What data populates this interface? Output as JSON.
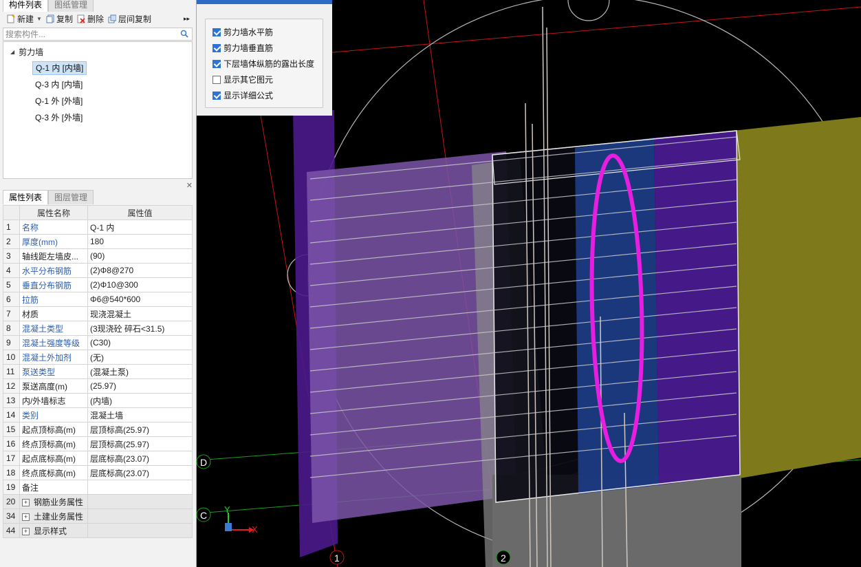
{
  "left_panel": {
    "tabs": [
      "构件列表",
      "图纸管理"
    ],
    "toolbar": {
      "new_label": "新建",
      "copy_label": "复制",
      "delete_label": "删除",
      "floor_copy_label": "层间复制",
      "more": "▸▸"
    },
    "search_placeholder": "搜索构件...",
    "tree": {
      "root": "剪力墙",
      "items": [
        "Q-1 内 [内墙]",
        "Q-3 内 [内墙]",
        "Q-1 外 [外墙]",
        "Q-3 外 [外墙]"
      ]
    },
    "prop_tabs": [
      "属性列表",
      "图层管理"
    ],
    "prop_headers": [
      "属性名称",
      "属性值"
    ],
    "properties": [
      {
        "n": "1",
        "name": "名称",
        "value": "Q-1 内"
      },
      {
        "n": "2",
        "name": "厚度(mm)",
        "value": "180"
      },
      {
        "n": "3",
        "name": "轴线距左墙皮...",
        "value": "(90)"
      },
      {
        "n": "4",
        "name": "水平分布钢筋",
        "value": "(2)Φ8@270"
      },
      {
        "n": "5",
        "name": "垂直分布钢筋",
        "value": "(2)Φ10@300"
      },
      {
        "n": "6",
        "name": "拉筋",
        "value": "Φ6@540*600"
      },
      {
        "n": "7",
        "name": "材质",
        "value": "现浇混凝土"
      },
      {
        "n": "8",
        "name": "混凝土类型",
        "value": "(3现浇砼 碎石<31.5)"
      },
      {
        "n": "9",
        "name": "混凝土强度等级",
        "value": "(C30)"
      },
      {
        "n": "10",
        "name": "混凝土外加剂",
        "value": "(无)"
      },
      {
        "n": "11",
        "name": "泵送类型",
        "value": "(混凝土泵)"
      },
      {
        "n": "12",
        "name": "泵送高度(m)",
        "value": "(25.97)"
      },
      {
        "n": "13",
        "name": "内/外墙标志",
        "value": "(内墙)"
      },
      {
        "n": "14",
        "name": "类别",
        "value": "混凝土墙"
      },
      {
        "n": "15",
        "name": "起点顶标高(m)",
        "value": "层顶标高(25.97)"
      },
      {
        "n": "16",
        "name": "终点顶标高(m)",
        "value": "层顶标高(25.97)"
      },
      {
        "n": "17",
        "name": "起点底标高(m)",
        "value": "层底标高(23.07)"
      },
      {
        "n": "18",
        "name": "终点底标高(m)",
        "value": "层底标高(23.07)"
      },
      {
        "n": "19",
        "name": "备注",
        "value": ""
      }
    ],
    "groups": [
      {
        "n": "20",
        "name": "钢筋业务属性"
      },
      {
        "n": "34",
        "name": "土建业务属性"
      },
      {
        "n": "44",
        "name": "显示样式"
      }
    ]
  },
  "check_panel": {
    "options": [
      {
        "label": "剪力墙水平筋",
        "checked": true
      },
      {
        "label": "剪力墙垂直筋",
        "checked": true
      },
      {
        "label": "下层墙体纵筋的露出长度",
        "checked": true
      },
      {
        "label": "显示其它图元",
        "checked": false
      },
      {
        "label": "显示详细公式",
        "checked": true
      }
    ]
  },
  "viewport": {
    "axis_labels": [
      "D",
      "C",
      "1",
      "2"
    ],
    "gizmo": {
      "x": "X",
      "y": "Y"
    },
    "colors": {
      "highlight": "#e51ee0",
      "wall_purple": "#7a55b8",
      "wall_yellow": "#7e7a1c"
    }
  }
}
